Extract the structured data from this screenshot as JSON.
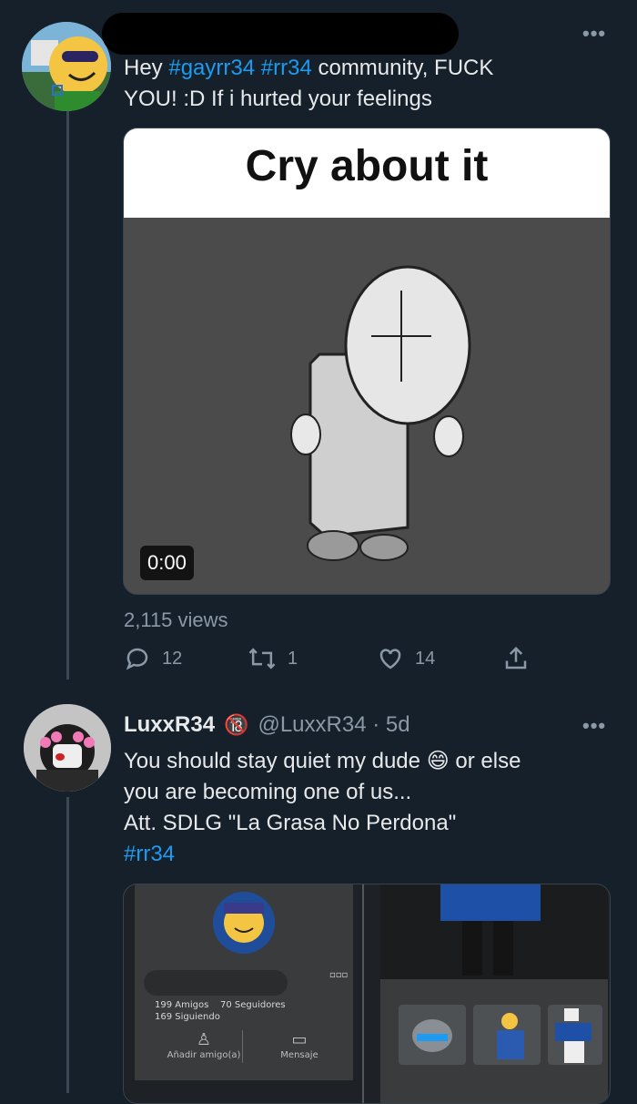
{
  "tweet1": {
    "text_prefix": "Hey ",
    "hashtag1": "#gayrr34",
    "hashtag2": "#rr34",
    "text_line1_rest": " community, FUCK",
    "text_line2": "YOU! :D If i hurted your feelings",
    "media_caption": "Cry about it",
    "video_time": "0:00",
    "views": "2,115 views",
    "replies": "12",
    "retweets": "1",
    "likes": "14"
  },
  "tweet2": {
    "display_name": "LuxxR34",
    "handle_time": "@LuxxR34 · 5d",
    "line1_before_emoji": "You should stay quiet my dude",
    "line1_after_emoji": "or else",
    "line2": "you are becoming one of us...",
    "line3": "Att. SDLG \"La Grasa No Perdona\"",
    "hashtag": "#rr34",
    "emoji": "😄",
    "badge": "🔞",
    "embedded_profile": {
      "friends": "199 Amigos",
      "followers": "70 Seguidores",
      "following": "169 Siguiendo",
      "add_friend": "Añadir amigo(a)",
      "message": "Mensaje"
    }
  },
  "colors": {
    "background": "#15202b",
    "link": "#1d9bf0",
    "secondary": "#8b98a5"
  }
}
